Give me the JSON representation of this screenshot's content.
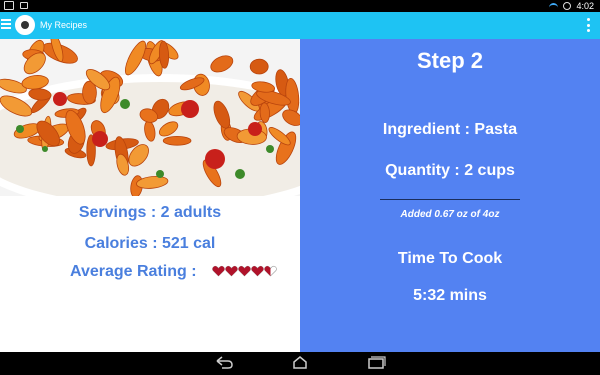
{
  "status_bar": {
    "time": "4:02"
  },
  "app_bar": {
    "title": "My Recipes"
  },
  "recipe": {
    "servings": "Servings : 2 adults",
    "calories": "Calories : 521 cal",
    "rating_label": "Average Rating :",
    "rating": {
      "value": 4.5,
      "max": 5
    }
  },
  "step": {
    "title": "Step 2",
    "ingredient": "Ingredient : Pasta",
    "quantity": "Quantity : 2 cups",
    "added_note": "Added 0.67 oz of 4oz",
    "time_label": "Time To Cook",
    "time_value": "5:32 mins"
  },
  "colors": {
    "app_bar": "#1ec3f3",
    "step_panel": "#5382f2",
    "info_text": "#4a7fde",
    "heart": "#b0122a"
  },
  "icons": [
    "menu-icon",
    "app-logo-icon",
    "overflow-menu-icon",
    "heart-icon",
    "back-icon",
    "home-icon",
    "recent-apps-icon",
    "wifi-icon",
    "alarm-icon"
  ]
}
